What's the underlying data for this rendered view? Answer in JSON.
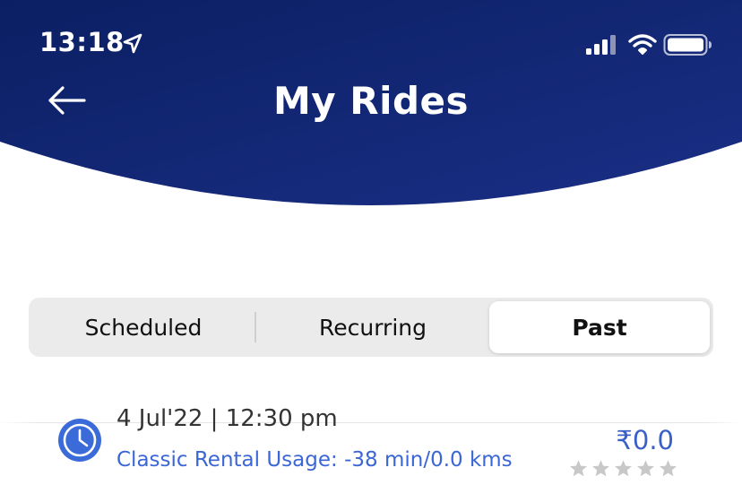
{
  "status_bar": {
    "time": "13:18",
    "location_icon": "location-arrow-icon",
    "signal_icon": "cellular-signal-icon",
    "wifi_icon": "wifi-icon",
    "battery_icon": "battery-icon"
  },
  "header": {
    "title": "My Rides",
    "back_icon": "back-arrow-icon",
    "background_color_top": "#0b1f63",
    "background_color_bottom": "#1a2f86"
  },
  "tabs": [
    {
      "label": "Scheduled",
      "selected": false
    },
    {
      "label": "Recurring",
      "selected": false
    },
    {
      "label": "Past",
      "selected": true
    }
  ],
  "rides": [
    {
      "date_time": "4 Jul'22 | 12:30 pm",
      "usage": "Classic Rental Usage: -38 min/0.0 kms",
      "fare": "₹0.0",
      "rating": 0,
      "rating_max": 5,
      "icon": "clock-icon"
    }
  ],
  "colors": {
    "accent": "#3b66d6",
    "icon_blue": "#3a6bd8",
    "star_empty": "#c8c8c8"
  }
}
